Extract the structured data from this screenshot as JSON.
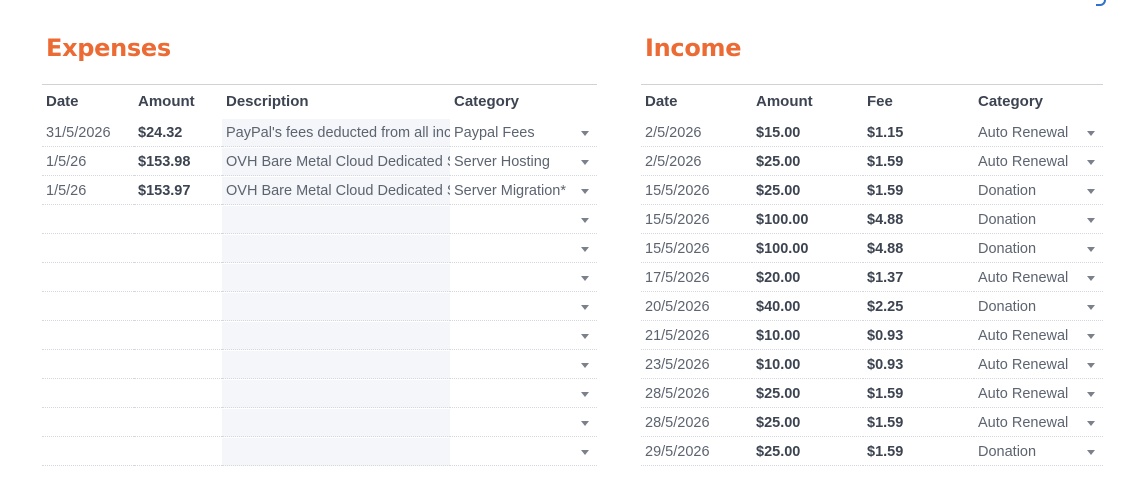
{
  "expenses": {
    "title": "Expenses",
    "headers": {
      "date": "Date",
      "amount": "Amount",
      "description": "Description",
      "category": "Category"
    },
    "rows": [
      {
        "date": "31/5/2026",
        "amount": "$24.32",
        "description": "PayPal's fees deducted from all income",
        "category": "Paypal Fees"
      },
      {
        "date": "1/5/26",
        "amount": "$153.98",
        "description": "OVH Bare Metal Cloud Dedicated Server",
        "category": "Server Hosting"
      },
      {
        "date": "1/5/26",
        "amount": "$153.97",
        "description": "OVH Bare Metal Cloud Dedicated Server",
        "category": "Server Migration*"
      },
      {
        "date": "",
        "amount": "",
        "description": "",
        "category": ""
      },
      {
        "date": "",
        "amount": "",
        "description": "",
        "category": ""
      },
      {
        "date": "",
        "amount": "",
        "description": "",
        "category": ""
      },
      {
        "date": "",
        "amount": "",
        "description": "",
        "category": ""
      },
      {
        "date": "",
        "amount": "",
        "description": "",
        "category": ""
      },
      {
        "date": "",
        "amount": "",
        "description": "",
        "category": ""
      },
      {
        "date": "",
        "amount": "",
        "description": "",
        "category": ""
      },
      {
        "date": "",
        "amount": "",
        "description": "",
        "category": ""
      },
      {
        "date": "",
        "amount": "",
        "description": "",
        "category": ""
      }
    ]
  },
  "income": {
    "title": "Income",
    "headers": {
      "date": "Date",
      "amount": "Amount",
      "fee": "Fee",
      "category": "Category"
    },
    "rows": [
      {
        "date": "2/5/2026",
        "amount": "$15.00",
        "fee": "$1.15",
        "category": "Auto Renewal"
      },
      {
        "date": "2/5/2026",
        "amount": "$25.00",
        "fee": "$1.59",
        "category": "Auto Renewal"
      },
      {
        "date": "15/5/2026",
        "amount": "$25.00",
        "fee": "$1.59",
        "category": "Donation"
      },
      {
        "date": "15/5/2026",
        "amount": "$100.00",
        "fee": "$4.88",
        "category": "Donation"
      },
      {
        "date": "15/5/2026",
        "amount": "$100.00",
        "fee": "$4.88",
        "category": "Donation"
      },
      {
        "date": "17/5/2026",
        "amount": "$20.00",
        "fee": "$1.37",
        "category": "Auto Renewal"
      },
      {
        "date": "20/5/2026",
        "amount": "$40.00",
        "fee": "$2.25",
        "category": "Donation"
      },
      {
        "date": "21/5/2026",
        "amount": "$10.00",
        "fee": "$0.93",
        "category": "Auto Renewal"
      },
      {
        "date": "23/5/2026",
        "amount": "$10.00",
        "fee": "$0.93",
        "category": "Auto Renewal"
      },
      {
        "date": "28/5/2026",
        "amount": "$25.00",
        "fee": "$1.59",
        "category": "Auto Renewal"
      },
      {
        "date": "28/5/2026",
        "amount": "$25.00",
        "fee": "$1.59",
        "category": "Auto Renewal"
      },
      {
        "date": "29/5/2026",
        "amount": "$25.00",
        "fee": "$1.59",
        "category": "Donation"
      }
    ]
  },
  "colors": {
    "title": "#ec6a33",
    "header_text": "#3d4451",
    "body_text": "#5d6470",
    "description_fill": "#f4f6f9"
  },
  "icons": {
    "dropdown": "chevron-down-icon"
  }
}
